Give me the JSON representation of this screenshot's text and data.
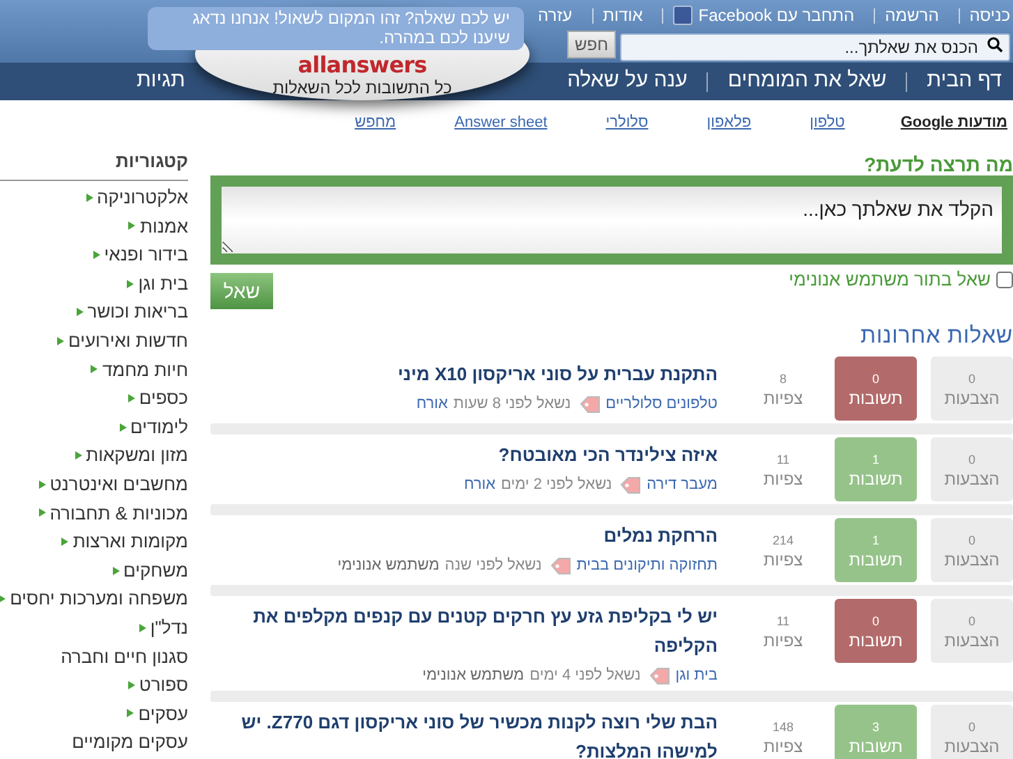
{
  "top_links": [
    {
      "label": "כניסה",
      "kind": "text"
    },
    {
      "label": "הרשמה",
      "kind": "text"
    },
    {
      "label": "התחבר עם Facebook",
      "kind": "facebook"
    },
    {
      "label": "אודות",
      "kind": "text"
    },
    {
      "label": "עזרה",
      "kind": "text"
    }
  ],
  "search": {
    "placeholder": "הכנס את שאלתך...",
    "button": "חפש"
  },
  "logo": {
    "wordmark": "allanswers",
    "tagline": "כל התשובות לכל השאלות",
    "bubble": "יש לכם שאלה? זהו המקום לשאול! אנחנו נדאג שיענו לכם במהרה."
  },
  "nav": [
    "דף הבית",
    "שאל את המומחים",
    "ענה על שאלה",
    "תגיות"
  ],
  "ads": {
    "label": "מודעות Google",
    "links": [
      "טלפון",
      "פלאפון",
      "סלולרי",
      "Answer sheet",
      "מחפש"
    ]
  },
  "sidebar": {
    "title": "קטגוריות",
    "items": [
      {
        "label": "אלקטרוניקה",
        "has_children": true
      },
      {
        "label": "אמנות",
        "has_children": true
      },
      {
        "label": "בידור ופנאי",
        "has_children": true
      },
      {
        "label": "בית וגן",
        "has_children": true
      },
      {
        "label": "בריאות וכושר",
        "has_children": true
      },
      {
        "label": "חדשות ואירועים",
        "has_children": true
      },
      {
        "label": "חיות מחמד",
        "has_children": true
      },
      {
        "label": "כספים",
        "has_children": true
      },
      {
        "label": "לימודים",
        "has_children": true
      },
      {
        "label": "מזון ומשקאות",
        "has_children": true
      },
      {
        "label": "מחשבים ואינטרנט",
        "has_children": true
      },
      {
        "label": "מכוניות & תחבורה",
        "has_children": true
      },
      {
        "label": "מקומות וארצות",
        "has_children": true
      },
      {
        "label": "משחקים",
        "has_children": true
      },
      {
        "label": "משפחה ומערכות יחסים",
        "has_children": true
      },
      {
        "label": "נדל\"ן",
        "has_children": true
      },
      {
        "label": "סגנון חיים וחברה",
        "has_children": false
      },
      {
        "label": "ספורט",
        "has_children": true
      },
      {
        "label": "עסקים",
        "has_children": true
      },
      {
        "label": "עסקים מקומיים",
        "has_children": false
      }
    ]
  },
  "ask": {
    "title": "מה תרצה לדעת?",
    "placeholder": "הקלד את שאלתך כאן...",
    "anonymous_label": "שאל בתור משתמש אנונימי",
    "anonymous_checked": false,
    "button": "שאל"
  },
  "recent": {
    "title": "שאלות אחרונות",
    "questions": [
      {
        "votes": "0",
        "votes_label": "הצבעות",
        "answers": "0",
        "answers_label": "תשובות",
        "answered": false,
        "views": "8",
        "views_label": "צפיות",
        "title": "התקנת עברית על סוני אריקסון X10 מיני",
        "tag": "טלפונים סלולריים",
        "asked": "נשאל לפני 8 שעות",
        "author": "אורח",
        "author_registered": true
      },
      {
        "votes": "0",
        "votes_label": "הצבעות",
        "answers": "1",
        "answers_label": "תשובות",
        "answered": true,
        "views": "11",
        "views_label": "צפיות",
        "title": "איזה צילינדר הכי מאובטח?",
        "tag": "מעבר דירה",
        "asked": "נשאל לפני 2 ימים",
        "author": "אורח",
        "author_registered": true
      },
      {
        "votes": "0",
        "votes_label": "הצבעות",
        "answers": "1",
        "answers_label": "תשובות",
        "answered": true,
        "views": "214",
        "views_label": "צפיות",
        "title": "הרחקת נמלים",
        "tag": "תחזוקה ותיקונים בבית",
        "asked": "נשאל לפני שנה",
        "author": "משתמש אנונימי",
        "author_registered": false
      },
      {
        "votes": "0",
        "votes_label": "הצבעות",
        "answers": "0",
        "answers_label": "תשובות",
        "answered": false,
        "views": "11",
        "views_label": "צפיות",
        "title": "יש לי בקליפת גזע עץ חרקים קטנים עם קנפים מקלפים את הקליפה",
        "tag": "בית וגן",
        "asked": "נשאל לפני 4 ימים",
        "author": "משתמש אנונימי",
        "author_registered": false
      },
      {
        "votes": "0",
        "votes_label": "הצבעות",
        "answers": "3",
        "answers_label": "תשובות",
        "answered": true,
        "views": "148",
        "views_label": "צפיות",
        "title": "הבת שלי רוצה לקנות מכשיר של סוני אריקסון דגם Z770. יש למישהו המלצות?"
      }
    ]
  }
}
